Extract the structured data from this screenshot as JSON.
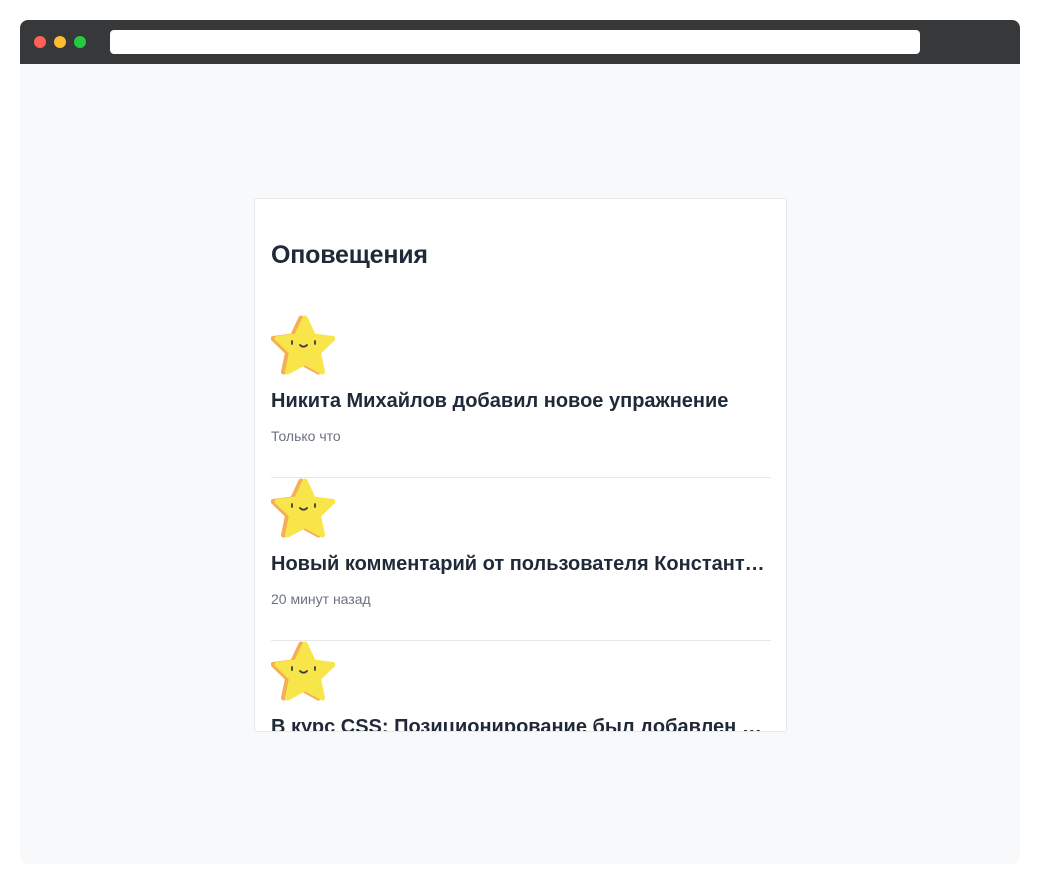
{
  "browser": {
    "url": ""
  },
  "notifications": {
    "title": "Оповещения",
    "icon": "star-icon",
    "colors": {
      "star_fill": "#f8e54a",
      "star_shadow": "#f4ae55",
      "title": "#1f2937",
      "meta": "#6b7280"
    },
    "items": [
      {
        "title": "Никита Михайлов добавил новое упражнение",
        "time": "Только что"
      },
      {
        "title": "Новый комментарий от пользователя Константина Петрова",
        "time": "20 минут назад"
      },
      {
        "title": "В курс CSS: Позиционирование был добавлен новый урок",
        "time": ""
      }
    ]
  }
}
